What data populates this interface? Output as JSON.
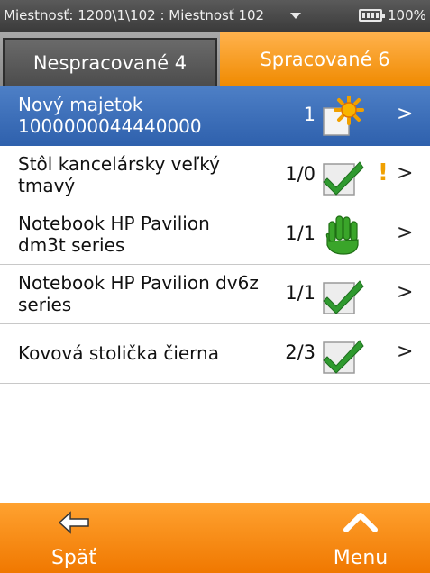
{
  "status_bar": {
    "location": "Miestnosť: 1200\\1\\102 : Miestnosť 102",
    "battery": "100%"
  },
  "tabs": [
    {
      "label": "Nespracované 4",
      "active": false
    },
    {
      "label": "Spracované 6",
      "active": true
    }
  ],
  "items": [
    {
      "name": "Nový majetok 1000000044440000",
      "count": "1",
      "icon": "new-asset-sun-icon",
      "warning": false,
      "selected": true
    },
    {
      "name": "Stôl kancelársky veľký tmavý",
      "count": "1/0",
      "icon": "checkmark-icon",
      "warning": true,
      "warning_text": "!",
      "selected": false
    },
    {
      "name": "Notebook HP Pavilion dm3t series",
      "count": "1/1",
      "icon": "hand-stop-icon",
      "warning": false,
      "selected": false
    },
    {
      "name": "Notebook HP Pavilion dv6z series",
      "count": "1/1",
      "icon": "checkmark-icon",
      "warning": false,
      "selected": false
    },
    {
      "name": "Kovová stolička čierna",
      "count": "2/3",
      "icon": "checkmark-icon",
      "warning": false,
      "selected": false
    }
  ],
  "chevron": ">",
  "bottom_bar": {
    "back_label": "Späť",
    "menu_label": "Menu"
  },
  "colors": {
    "accent": "#f08a00",
    "selected_row": "#3a6db8",
    "status_bar": "#4a4a4a",
    "warning": "#f0a000"
  }
}
